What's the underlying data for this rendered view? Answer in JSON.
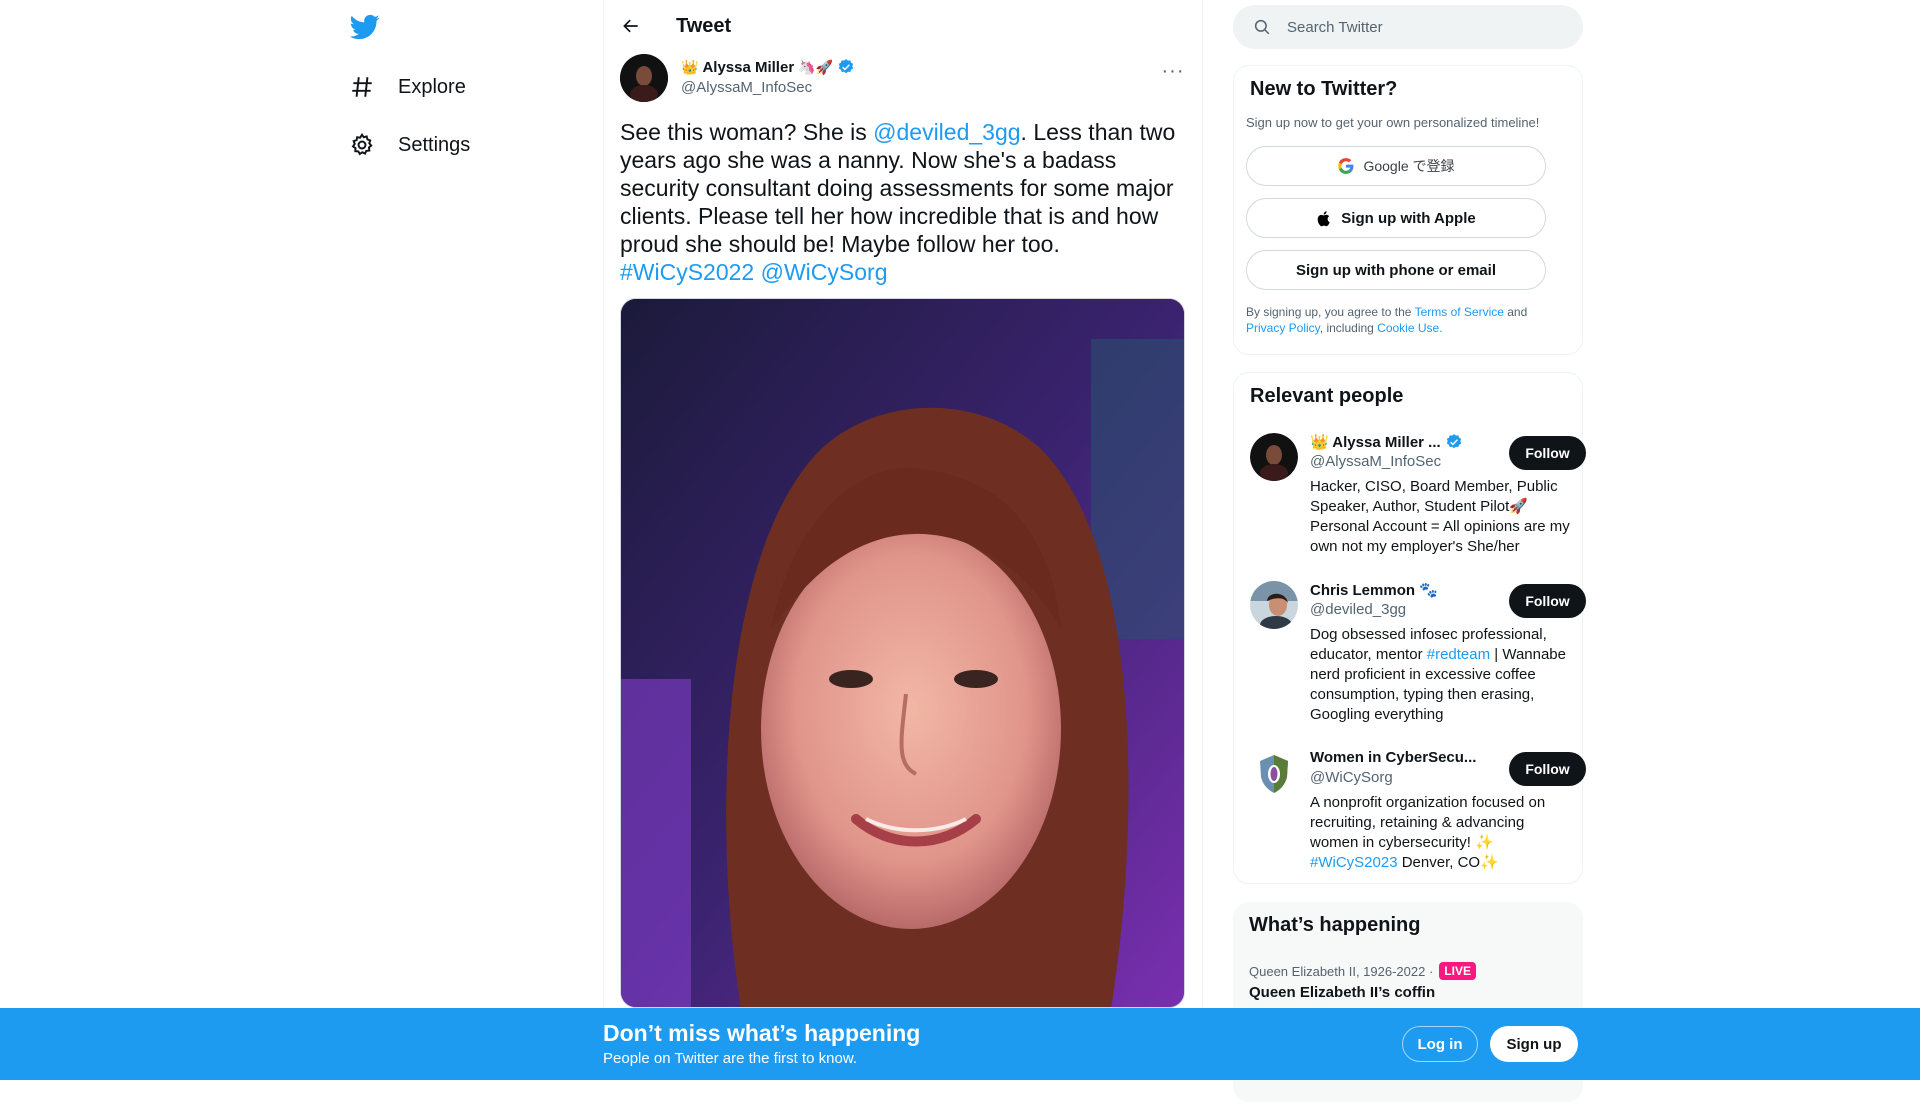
{
  "nav": {
    "explore_label": "Explore",
    "settings_label": "Settings"
  },
  "header": {
    "title": "Tweet"
  },
  "tweet": {
    "author_name": "Alyssa Miller",
    "author_emoji_prefix": "👑",
    "author_emoji_suffix": "🦄🚀",
    "author_handle": "@AlyssaM_InfoSec",
    "text_part1": "See this woman? She is ",
    "mention1": "@deviled_3gg",
    "text_part2": ". Less than two years ago she was a nanny. Now she's a badass security consultant doing assessments for some major clients.  Please tell her how incredible that is and how proud she should be! Maybe follow her too.",
    "hashtag": "#WiCyS2022",
    "mention2": "@WiCySorg"
  },
  "search": {
    "placeholder": "Search Twitter"
  },
  "new_to_twitter": {
    "title": "New to Twitter?",
    "subtitle": "Sign up now to get your own personalized timeline!",
    "google_label": "Google で登録",
    "apple_label": "Sign up with Apple",
    "phone_label": "Sign up with phone or email",
    "terms_prefix": "By signing up, you agree to the ",
    "terms_link": "Terms of Service",
    "terms_and": " and",
    "privacy_link": "Privacy Policy",
    "including": ", including ",
    "cookie_link": "Cookie Use."
  },
  "relevant_people": {
    "title": "Relevant people",
    "follow_label": "Follow",
    "people": [
      {
        "name": "👑 Alyssa Miller ...",
        "handle": "@AlyssaM_InfoSec",
        "bio": "Hacker, CISO, Board Member, Public Speaker, Author, Student Pilot🚀 Personal Account = All opinions are my own not my employer's She/her"
      },
      {
        "name": "Chris Lemmon 🐾",
        "handle": "@deviled_3gg",
        "bio_part1": "Dog obsessed infosec professional, educator, mentor ",
        "bio_tag": "#redteam",
        "bio_part2": " | Wannabe nerd proficient in excessive coffee consumption, typing then erasing, Googling everything"
      },
      {
        "name": "Women in CyberSecu...",
        "handle": "@WiCySorg",
        "bio_part1": "A nonprofit organization focused on recruiting, retaining & advancing women in cybersecurity! ✨",
        "bio_tag": "#WiCyS2023",
        "bio_part2": " Denver, CO✨"
      }
    ]
  },
  "whats_happening": {
    "title": "What’s happening",
    "meta": "Queen Elizabeth II, 1926-2022 ·",
    "live": "LIVE",
    "headline": "Queen Elizabeth II’s coffin"
  },
  "bottom_bar": {
    "title": "Don’t miss what’s happening",
    "subtitle": "People on Twitter are the first to know.",
    "login": "Log in",
    "signup": "Sign up"
  },
  "colors": {
    "brand": "#1d9bf0",
    "text": "#0f1419",
    "muted": "#536471",
    "live": "#f91880"
  }
}
